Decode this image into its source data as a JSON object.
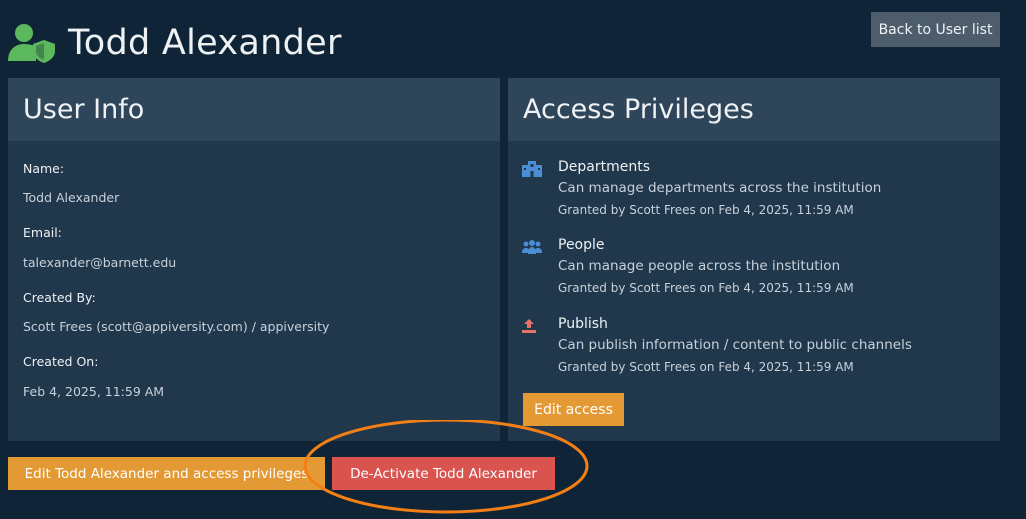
{
  "header": {
    "title": "Todd Alexander",
    "back_label": "Back to User list"
  },
  "user_info": {
    "heading": "User Info",
    "fields": [
      {
        "label": "Name:",
        "value": "Todd Alexander"
      },
      {
        "label": "Email:",
        "value": "talexander@barnett.edu"
      },
      {
        "label": "Created By:",
        "value": "Scott Frees (scott@appiversity.com) / appiversity"
      },
      {
        "label": "Created On:",
        "value": "Feb 4, 2025, 11:59 AM"
      }
    ]
  },
  "access": {
    "heading": "Access Privileges",
    "privileges": [
      {
        "icon": "building-icon",
        "title": "Departments",
        "description": "Can manage departments across the institution",
        "granted": "Granted by Scott Frees on Feb 4, 2025, 11:59 AM"
      },
      {
        "icon": "people-icon",
        "title": "People",
        "description": "Can manage people across the institution",
        "granted": "Granted by Scott Frees on Feb 4, 2025, 11:59 AM"
      },
      {
        "icon": "publish-icon",
        "title": "Publish",
        "description": "Can publish information / content to public channels",
        "granted": "Granted by Scott Frees on Feb 4, 2025, 11:59 AM"
      }
    ],
    "edit_label": "Edit access"
  },
  "actions": {
    "edit_label": "Edit Todd Alexander and access privileges",
    "deactivate_label": "De-Activate Todd Alexander"
  },
  "colors": {
    "background": "#0f2537",
    "card": "#20374c",
    "card_header": "#2f465a",
    "accent_green": "#5cb85c",
    "warning": "#e39a35",
    "danger": "#d9534f",
    "annotation": "#f47f14"
  }
}
